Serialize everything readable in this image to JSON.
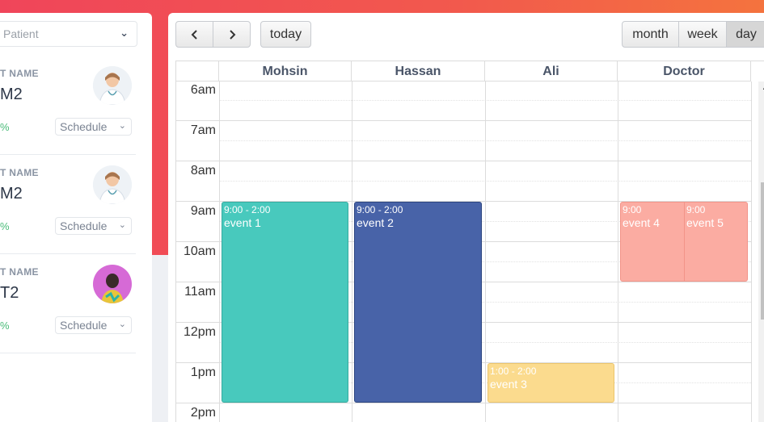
{
  "left": {
    "select_placeholder": "Patient",
    "patients": [
      {
        "label": "T NAME",
        "name": "M2",
        "percent": "%",
        "schedule": "Schedule",
        "avatar": "doctor-avatar"
      },
      {
        "label": "T NAME",
        "name": "M2",
        "percent": "%",
        "schedule": "Schedule",
        "avatar": "doctor-avatar"
      },
      {
        "label": "T NAME",
        "name": "T2",
        "percent": "%",
        "schedule": "Schedule",
        "avatar": "person-avatar"
      }
    ]
  },
  "toolbar": {
    "prev_icon": "chevron-left-icon",
    "next_icon": "chevron-right-icon",
    "today_label": "today",
    "views": [
      "month",
      "week",
      "day"
    ],
    "active_view": "day"
  },
  "resources": [
    "Mohsin",
    "Hassan",
    "Ali",
    "Doctor"
  ],
  "time_labels": [
    "6am",
    "7am",
    "8am",
    "9am",
    "10am",
    "11am",
    "12pm",
    "1pm",
    "2pm"
  ],
  "events": [
    {
      "resource": "Mohsin",
      "time": "9:00 - 2:00",
      "title": "event 1",
      "color": "#48c9bd"
    },
    {
      "resource": "Hassan",
      "time": "9:00 - 2:00",
      "title": "event 2",
      "color": "#4863a8"
    },
    {
      "resource": "Ali",
      "time": "1:00 - 2:00",
      "title": "event 3",
      "color": "#fbdb8e"
    },
    {
      "resource": "Doctor",
      "time": "9:00",
      "title": "event 4",
      "color": "#fbaca2"
    },
    {
      "resource": "Doctor",
      "time": "9:00",
      "title": "event 5",
      "color": "#fbaca2"
    }
  ],
  "colors": {
    "header_gradient_start": "#f0455a",
    "header_gradient_end": "#f4733e",
    "percent_green": "#48bb78"
  }
}
